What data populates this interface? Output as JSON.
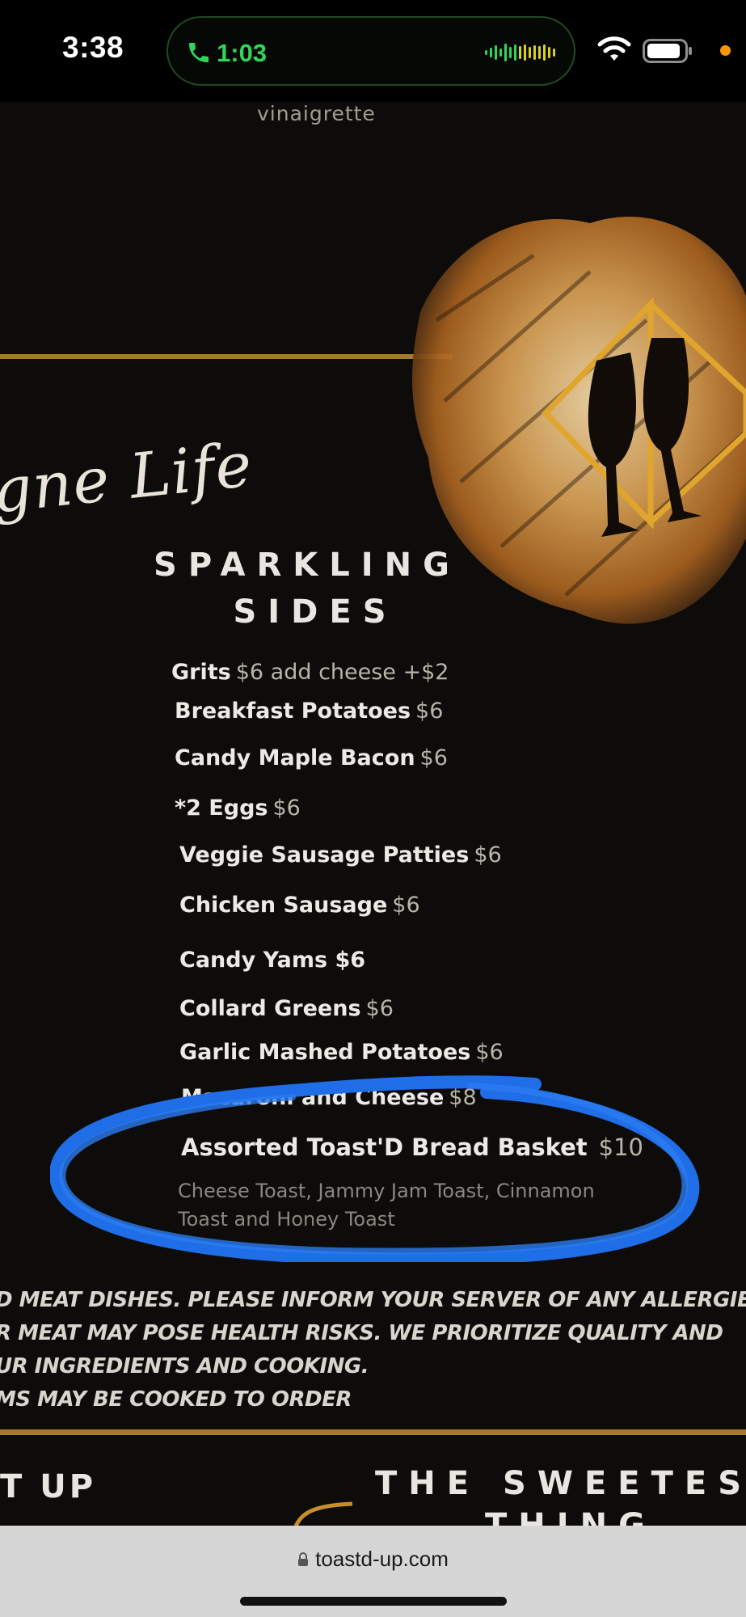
{
  "status_bar": {
    "time": "3:38",
    "call_duration": "1:03",
    "call_color": "#33d45a",
    "indicator_color": "#ff9500"
  },
  "menu_page": {
    "top_text": "vinaigrette",
    "script_text": "gne Life",
    "section_title_line1": "SPARKLING",
    "section_title_line2": "SIDES",
    "items": [
      {
        "name": "Grits",
        "price": "$6 add cheese +$2"
      },
      {
        "name": "Breakfast Potatoes",
        "price": "$6"
      },
      {
        "name": "Candy Maple Bacon",
        "price": "$6"
      },
      {
        "name": "*2 Eggs",
        "price": "$6"
      },
      {
        "name": "Veggie Sausage Patties",
        "price": "$6"
      },
      {
        "name": "Chicken Sausage",
        "price": "$6"
      },
      {
        "name": "Candy Yams $6",
        "price": ""
      },
      {
        "name": "Collard Greens",
        "price": "$6"
      },
      {
        "name": "Garlic Mashed Potatoes",
        "price": "$6"
      },
      {
        "name": "Macaroni and Cheese",
        "price": "$8"
      },
      {
        "name": "Assorted Toast'D Bread Basket",
        "price": "$10"
      }
    ],
    "bread_basket_description": "Cheese Toast, Jammy Jam Toast, Cinnamon Toast and Honey Toast",
    "disclaimer_lines": [
      "D MEAT DISHES. PLEASE INFORM YOUR SERVER OF ANY ALLERGIES.",
      "R MEAT MAY POSE HEALTH RISKS. WE PRIORITIZE QUALITY AND",
      "UR INGREDIENTS AND COOKING.",
      "MS MAY BE COOKED TO ORDER"
    ],
    "bottom_left_heading": "T UP",
    "bottom_right_heading": "THE SWEETEST",
    "bottom_right_heading2": "THING",
    "accent_gold": "#a57a2c",
    "annotation_color": "#1f6ee8"
  },
  "browser": {
    "url": "toastd-up.com"
  }
}
